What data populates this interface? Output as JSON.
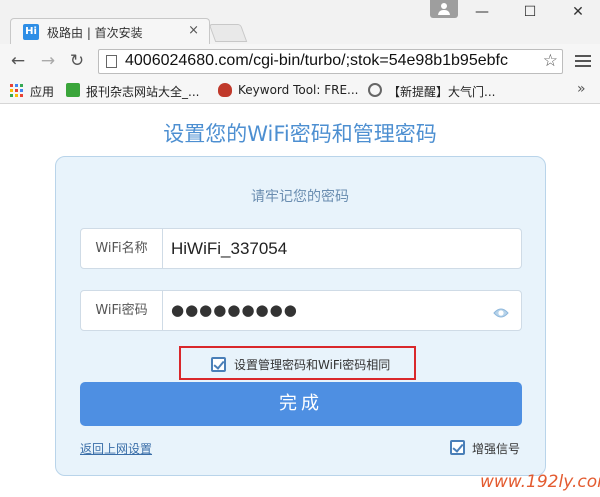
{
  "browser": {
    "tab_title": "极路由 | 首次安装",
    "tab_favicon_text": "Hi",
    "tab_close": "×",
    "url": "4006024680.com/cgi-bin/turbo/;stok=54e98b1b95ebfc",
    "window_minimize": "—",
    "window_maximize": "☐",
    "window_close": "✕",
    "back_glyph": "←",
    "forward_glyph": "→",
    "reload_glyph": "↻",
    "star_glyph": "☆",
    "bookmarks_more": "»",
    "bookmarks": [
      {
        "label": "应用",
        "icon": "apps-grid-icon"
      },
      {
        "label": "报刊杂志网站大全_...",
        "icon": "green-c-icon"
      },
      {
        "label": "Keyword Tool: FRE...",
        "icon": "flame-icon"
      },
      {
        "label": "【新提醒】大气门...",
        "icon": "wordpress-icon"
      }
    ]
  },
  "page": {
    "title": "设置您的WiFi密码和管理密码",
    "subtitle": "请牢记您的密码",
    "wifi_name": {
      "label": "WiFi名称",
      "value": "HiWiFi_337054"
    },
    "wifi_password": {
      "label": "WiFi密码",
      "masked_value": "●●●●●●●●●"
    },
    "same_password_option": {
      "label": "设置管理密码和WiFi密码相同",
      "checked": true
    },
    "submit_label": "完成",
    "back_link": "返回上网设置",
    "boost_signal": {
      "label": "增强信号",
      "checked": true
    },
    "watermark": "www.192ly.com"
  },
  "colors": {
    "accent": "#4e8fe2",
    "title_blue": "#4d8fd1",
    "card_bg": "#e8f3fb",
    "highlight_red": "#d9272b"
  }
}
